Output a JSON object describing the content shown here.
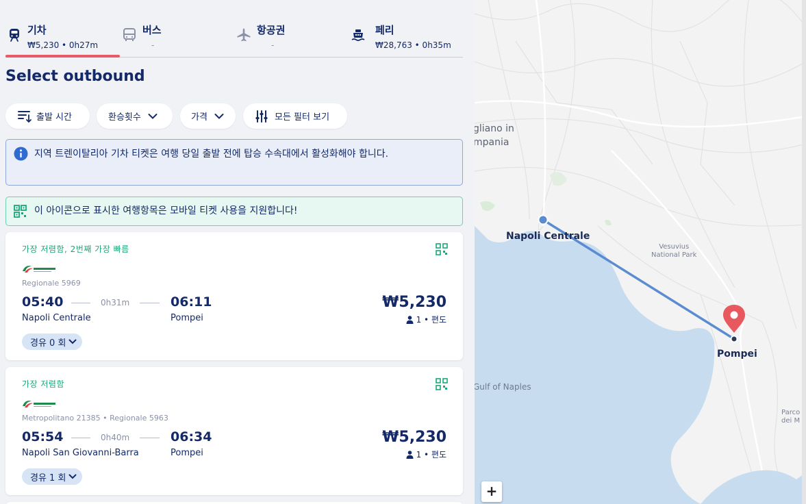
{
  "tabs": [
    {
      "label": "기차",
      "sub": "₩5,230 • 0h27m",
      "icon": "train-icon",
      "active": true
    },
    {
      "label": "버스",
      "sub": "-",
      "icon": "bus-icon",
      "active": false
    },
    {
      "label": "항공권",
      "sub": "-",
      "icon": "plane-icon",
      "active": false
    },
    {
      "label": "페리",
      "sub": "₩28,763 • 0h35m",
      "icon": "ferry-icon",
      "active": false
    }
  ],
  "page_title": "Select outbound",
  "filters": {
    "departure_time": "출발 시간",
    "transfers": "환승횟수",
    "price": "가격",
    "all_filters": "모든 필터 보기"
  },
  "notices": {
    "info": "지역 트렌이탈리아 기차 티켓은 여행 당일 출발 전에 탑승 수속대에서 활성화해야 합니다.",
    "mobile": "이 아이콘으로 표시한 여행항목은 모바일 티켓 사용을 지원합니다!"
  },
  "results": [
    {
      "tag": "가장 저렴함, 2번째 가장 빠름",
      "service": "Regionale 5969",
      "dep_time": "05:40",
      "duration": "0h31m",
      "arr_time": "06:11",
      "dep_station": "Napoli Centrale",
      "arr_station": "Pompei",
      "price": "₩5,230",
      "pax": "1 • 편도",
      "stops": "경유 0 회"
    },
    {
      "tag": "가장 저렴함",
      "service": "Metropolitano 21385 • Regionale 5963",
      "dep_time": "05:54",
      "duration": "0h40m",
      "arr_time": "06:34",
      "dep_station": "Napoli San Giovanni-Barra",
      "arr_station": "Pompei",
      "price": "₩5,230",
      "pax": "1 • 편도",
      "stops": "경유 1 회"
    }
  ],
  "map": {
    "labels": {
      "origin": "Napoli Centrale",
      "destination": "Pompei",
      "vesuvius": "Vesuvius\nNational Park",
      "gulf": "Gulf of Naples",
      "giugliano": "gliano in\nmpania",
      "parco": "Parco\ndei M"
    },
    "zoom_in": "+",
    "route_color": "#5b8bd0",
    "pin_color": "#e8585f"
  },
  "colors": {
    "accent": "#e85a66",
    "navy": "#132968",
    "green": "#18a875"
  }
}
